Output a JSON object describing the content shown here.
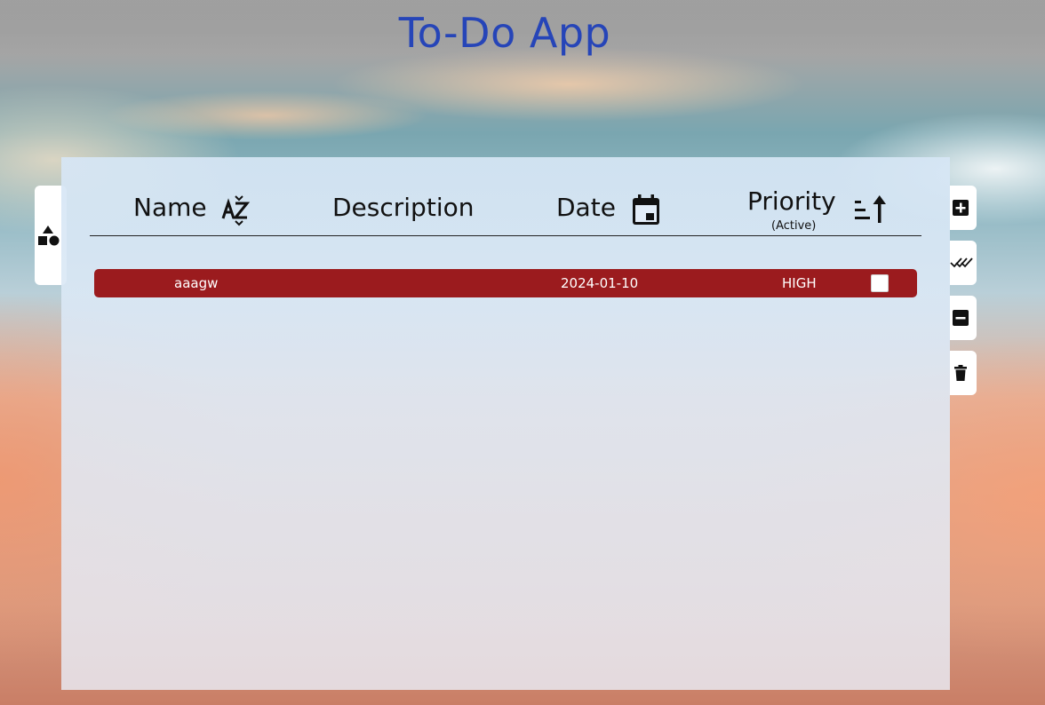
{
  "app": {
    "title": "To-Do App"
  },
  "table": {
    "headers": {
      "name": "Name",
      "description": "Description",
      "date": "Date",
      "priority": "Priority",
      "priority_filter": "(Active)"
    },
    "rows": [
      {
        "name": "aaagw",
        "description": "",
        "date": "2024-01-10",
        "priority": "HIGH",
        "completed": false,
        "row_color": "#9b1b1e"
      }
    ]
  },
  "side_actions": [
    {
      "name": "add-task-button",
      "icon": "plus-square-icon"
    },
    {
      "name": "mark-done-button",
      "icon": "double-check-icon"
    },
    {
      "name": "remove-task-button",
      "icon": "minus-square-icon"
    },
    {
      "name": "delete-task-button",
      "icon": "trash-icon"
    }
  ],
  "left_tab": {
    "icon": "shapes-icon"
  },
  "colors": {
    "title": "#2645b8",
    "high_priority_row": "#9b1b1e",
    "panel": "#d6e6f5"
  }
}
